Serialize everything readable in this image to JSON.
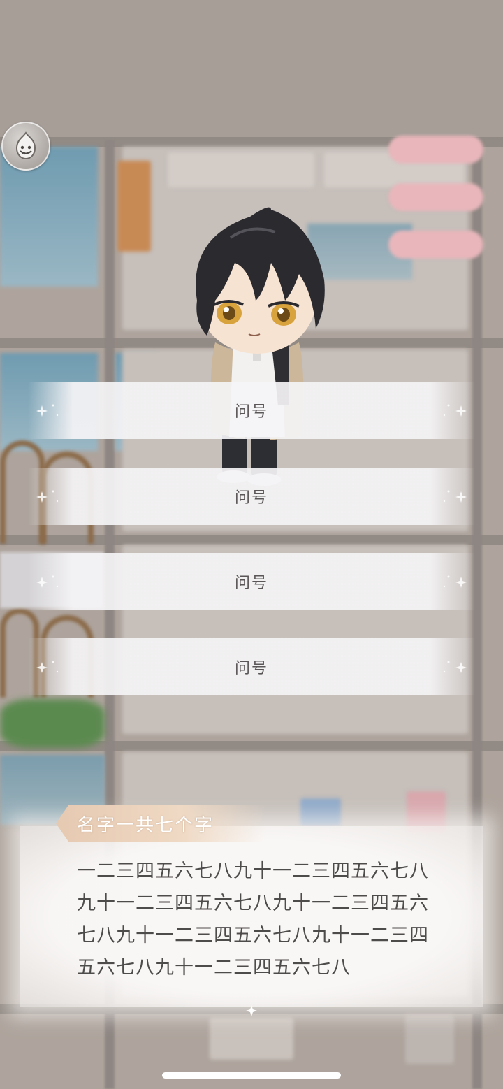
{
  "scene": {
    "avatar_icon": "wisp-mascot-icon",
    "accent_color": "#e6c9b1",
    "option_text_color": "#5a5657"
  },
  "choices": [
    {
      "label": "问号"
    },
    {
      "label": "问号"
    },
    {
      "label": "问号"
    },
    {
      "label": "问号"
    }
  ],
  "dialogue": {
    "speaker": "名字一共七个字",
    "text": "一二三四五六七八九十一二三四五六七八九十一二三四五六七八九十一二三四五六七八九十一二三四五六七八九十一二三四五六七八九十一二三四五六七八"
  }
}
